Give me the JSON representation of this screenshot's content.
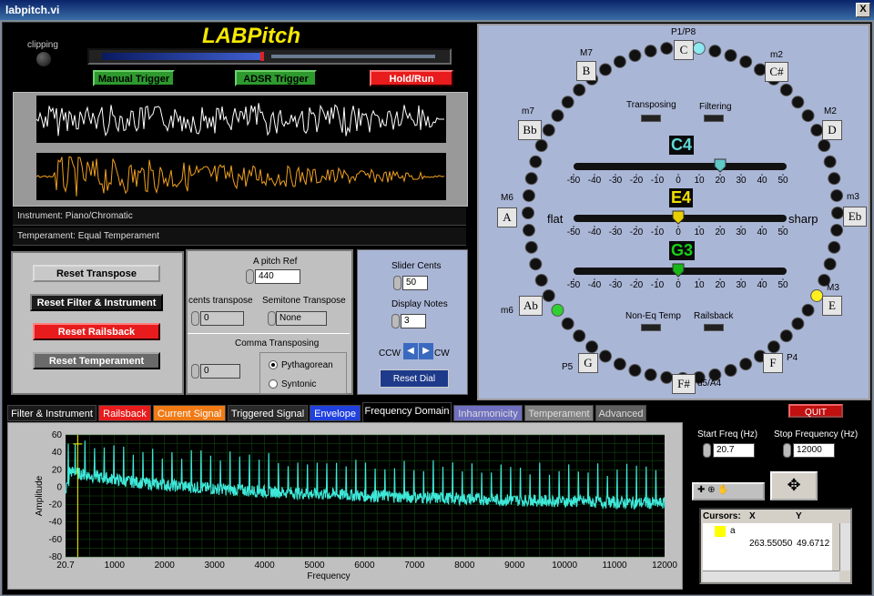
{
  "window": {
    "title": "labpitch.vi",
    "close": "X"
  },
  "header": {
    "app_title": "LABPitch",
    "clipping": "clipping"
  },
  "triggers": {
    "manual": "Manual Trigger",
    "adsr": "ADSR Trigger",
    "hold": "Hold/Run"
  },
  "info": {
    "instrument": "Instrument: Piano/Chromatic",
    "temperament": "Temperament: Equal Temperament"
  },
  "left_buttons": {
    "reset_transpose": "Reset Transpose",
    "reset_filter": "Reset Filter & Instrument",
    "reset_railsback": "Reset Railsback",
    "reset_temperament": "Reset  Temperament"
  },
  "pitch": {
    "a_pitch_label": "A pitch Ref",
    "a_pitch_value": "440",
    "cents_label": "cents transpose",
    "cents_value": "0",
    "semitone_label": "Semitone Transpose",
    "semitone_value": "None",
    "comma_label": "Comma Transposing",
    "comma_value": "0",
    "pythagorean": "Pythagorean",
    "syntonic": "Syntonic"
  },
  "display": {
    "slider_cents_label": "Slider Cents",
    "slider_cents_value": "50",
    "display_notes_label": "Display Notes",
    "display_notes_value": "3",
    "ccw": "CCW",
    "cw": "CW",
    "reset_dial": "Reset Dial"
  },
  "dial": {
    "notes": {
      "top": "C",
      "top_label": "P1/P8",
      "c_sharp": "C#",
      "c_sharp_label": "m2",
      "d": "D",
      "d_label": "M2",
      "eb": "Eb",
      "eb_label": "m3",
      "e": "E",
      "e_label": "M3",
      "f": "F",
      "f_label": "P4",
      "f_sharp": "F#",
      "f_sharp_label": "d5/A4",
      "g": "G",
      "g_label": "P5",
      "ab": "Ab",
      "ab_label": "m6",
      "a": "A",
      "a_label": "M6",
      "bb": "Bb",
      "bb_label": "m7",
      "b": "B",
      "b_label": "M7"
    },
    "transposing": "Transposing",
    "filtering": "Filtering",
    "non_eq": "Non-Eq Temp",
    "railsback": "Railsback",
    "flat": "flat",
    "sharp": "sharp",
    "sliders": [
      {
        "note": "C4",
        "cents": 20,
        "color": "#5fc8c8"
      },
      {
        "note": "E4",
        "cents": 0,
        "color": "#e8d000"
      },
      {
        "note": "G3",
        "cents": 0,
        "color": "#18b818"
      }
    ],
    "scale": [
      "-50",
      "-40",
      "-30",
      "-20",
      "-10",
      "0",
      "10",
      "20",
      "30",
      "40",
      "50"
    ]
  },
  "tabs": [
    {
      "label": "Filter & Instrument",
      "bg": "#1a1a1a"
    },
    {
      "label": "Railsback",
      "bg": "#e81c1c"
    },
    {
      "label": "Current Signal",
      "bg": "#f07a14"
    },
    {
      "label": "Triggered Signal",
      "bg": "#2a2a2a"
    },
    {
      "label": "Envelope",
      "bg": "#2040e0"
    },
    {
      "label": "Frequency Domain",
      "bg": "#000"
    },
    {
      "label": "Inharmonicity",
      "bg": "#7070c0"
    },
    {
      "label": "Temperament",
      "bg": "#808080"
    },
    {
      "label": "Advanced",
      "bg": "#606060"
    }
  ],
  "quit": "QUIT",
  "freq": {
    "start_label": "Start Freq (Hz)",
    "start_value": "20.7",
    "stop_label": "Stop Frequency (Hz)",
    "stop_value": "12000"
  },
  "cursors": {
    "title": "Cursors:",
    "x_label": "X",
    "y_label": "Y",
    "name": "a",
    "x": "263.55050",
    "y": "49.6712"
  },
  "chart_data": {
    "type": "line",
    "xlabel": "Frequency",
    "ylabel": "Amplitude",
    "xlim": [
      20.7,
      12000
    ],
    "ylim": [
      -80,
      60
    ],
    "xticks": [
      "20.7",
      "1000",
      "2000",
      "3000",
      "4000",
      "5000",
      "6000",
      "7000",
      "8000",
      "9000",
      "10000",
      "11000",
      "12000"
    ],
    "yticks": [
      "60",
      "40",
      "20",
      "0",
      "-20",
      "-40",
      "-60",
      "-80"
    ],
    "series_color": "#3ee8d8"
  }
}
